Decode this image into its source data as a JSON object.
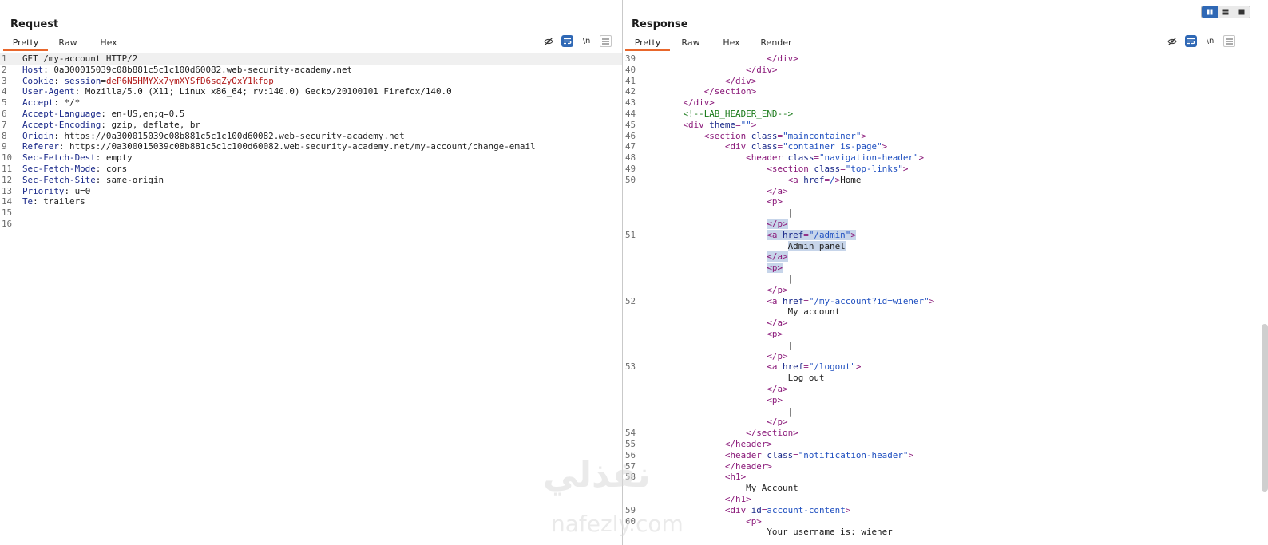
{
  "request": {
    "title": "Request",
    "tabs": [
      "Pretty",
      "Raw",
      "Hex"
    ],
    "active_tab": "Pretty",
    "lines": [
      {
        "n": "1",
        "parts": [
          [
            "hv",
            "GET /my-account HTTP/2"
          ]
        ]
      },
      {
        "n": "2",
        "parts": [
          [
            "hk",
            "Host"
          ],
          [
            "hv",
            ": 0a300015039c08b881c5c1c100d60082.web-security-academy.net"
          ]
        ]
      },
      {
        "n": "3",
        "parts": [
          [
            "hk",
            "Cookie"
          ],
          [
            "hv",
            ": "
          ],
          [
            "hk",
            "session"
          ],
          [
            "hv",
            "="
          ],
          [
            "ck",
            "deP6N5HMYXx7ymXYSfD6sqZyOxY1kfop"
          ]
        ]
      },
      {
        "n": "4",
        "parts": [
          [
            "hk",
            "User-Agent"
          ],
          [
            "hv",
            ": Mozilla/5.0 (X11; Linux x86_64; rv:140.0) Gecko/20100101 Firefox/140.0"
          ]
        ]
      },
      {
        "n": "5",
        "parts": [
          [
            "hk",
            "Accept"
          ],
          [
            "hv",
            ": */*"
          ]
        ]
      },
      {
        "n": "6",
        "parts": [
          [
            "hk",
            "Accept-Language"
          ],
          [
            "hv",
            ": en-US,en;q=0.5"
          ]
        ]
      },
      {
        "n": "7",
        "parts": [
          [
            "hk",
            "Accept-Encoding"
          ],
          [
            "hv",
            ": gzip, deflate, br"
          ]
        ]
      },
      {
        "n": "8",
        "parts": [
          [
            "hk",
            "Origin"
          ],
          [
            "hv",
            ": https://0a300015039c08b881c5c1c100d60082.web-security-academy.net"
          ]
        ]
      },
      {
        "n": "9",
        "parts": [
          [
            "hk",
            "Referer"
          ],
          [
            "hv",
            ": https://0a300015039c08b881c5c1c100d60082.web-security-academy.net/my-account/change-email"
          ]
        ]
      },
      {
        "n": "10",
        "parts": [
          [
            "hk",
            "Sec-Fetch-Dest"
          ],
          [
            "hv",
            ": empty"
          ]
        ]
      },
      {
        "n": "11",
        "parts": [
          [
            "hk",
            "Sec-Fetch-Mode"
          ],
          [
            "hv",
            ": cors"
          ]
        ]
      },
      {
        "n": "12",
        "parts": [
          [
            "hk",
            "Sec-Fetch-Site"
          ],
          [
            "hv",
            ": same-origin"
          ]
        ]
      },
      {
        "n": "13",
        "parts": [
          [
            "hk",
            "Priority"
          ],
          [
            "hv",
            ": u=0"
          ]
        ]
      },
      {
        "n": "14",
        "parts": [
          [
            "hk",
            "Te"
          ],
          [
            "hv",
            ": trailers"
          ]
        ]
      },
      {
        "n": "15",
        "parts": []
      },
      {
        "n": "16",
        "parts": []
      }
    ]
  },
  "response": {
    "title": "Response",
    "tabs": [
      "Pretty",
      "Raw",
      "Hex",
      "Render"
    ],
    "active_tab": "Pretty",
    "lines": [
      {
        "n": "39",
        "parts": [
          [
            "hv",
            "                        "
          ],
          [
            "tg",
            "</div>"
          ]
        ]
      },
      {
        "n": "40",
        "parts": [
          [
            "hv",
            "                    "
          ],
          [
            "tg",
            "</div>"
          ]
        ]
      },
      {
        "n": "41",
        "parts": [
          [
            "hv",
            "                "
          ],
          [
            "tg",
            "</div>"
          ]
        ]
      },
      {
        "n": "42",
        "parts": [
          [
            "hv",
            "            "
          ],
          [
            "tg",
            "</section>"
          ]
        ]
      },
      {
        "n": "43",
        "parts": [
          [
            "hv",
            "        "
          ],
          [
            "tg",
            "</div>"
          ]
        ]
      },
      {
        "n": "44",
        "parts": [
          [
            "hv",
            "        "
          ],
          [
            "cm",
            "<!--LAB_HEADER_END-->"
          ]
        ]
      },
      {
        "n": "45",
        "parts": [
          [
            "hv",
            "        "
          ],
          [
            "tg",
            "<div "
          ],
          [
            "at",
            "theme"
          ],
          [
            "tg",
            "="
          ],
          [
            "av",
            "\"\""
          ],
          [
            "tg",
            ">"
          ]
        ]
      },
      {
        "n": "46",
        "parts": [
          [
            "hv",
            "            "
          ],
          [
            "tg",
            "<section "
          ],
          [
            "at",
            "class"
          ],
          [
            "tg",
            "="
          ],
          [
            "av",
            "\"maincontainer\""
          ],
          [
            "tg",
            ">"
          ]
        ]
      },
      {
        "n": "47",
        "parts": [
          [
            "hv",
            "                "
          ],
          [
            "tg",
            "<div "
          ],
          [
            "at",
            "class"
          ],
          [
            "tg",
            "="
          ],
          [
            "av",
            "\"container is-page\""
          ],
          [
            "tg",
            ">"
          ]
        ]
      },
      {
        "n": "48",
        "parts": [
          [
            "hv",
            "                    "
          ],
          [
            "tg",
            "<header "
          ],
          [
            "at",
            "class"
          ],
          [
            "tg",
            "="
          ],
          [
            "av",
            "\"navigation-header\""
          ],
          [
            "tg",
            ">"
          ]
        ]
      },
      {
        "n": "49",
        "parts": [
          [
            "hv",
            "                        "
          ],
          [
            "tg",
            "<section "
          ],
          [
            "at",
            "class"
          ],
          [
            "tg",
            "="
          ],
          [
            "av",
            "\"top-links\""
          ],
          [
            "tg",
            ">"
          ]
        ]
      },
      {
        "n": "50",
        "parts": [
          [
            "hv",
            "                            "
          ],
          [
            "tg",
            "<a "
          ],
          [
            "at",
            "href"
          ],
          [
            "tg",
            "="
          ],
          [
            "av",
            "/"
          ],
          [
            "tg",
            ">"
          ],
          [
            "hv",
            "Home"
          ]
        ]
      },
      {
        "n": "",
        "parts": [
          [
            "hv",
            "                        "
          ],
          [
            "tg",
            "</a>"
          ]
        ]
      },
      {
        "n": "",
        "parts": [
          [
            "hv",
            "                        "
          ],
          [
            "tg",
            "<p>"
          ]
        ]
      },
      {
        "n": "",
        "parts": [
          [
            "hv",
            "                            |"
          ]
        ]
      },
      {
        "n": "",
        "sel": true,
        "parts": [
          [
            "hv",
            "                        "
          ],
          [
            "tg",
            "</p>"
          ]
        ]
      },
      {
        "n": "51",
        "sel": true,
        "parts": [
          [
            "hv",
            "                        "
          ],
          [
            "tg",
            "<a "
          ],
          [
            "at",
            "href"
          ],
          [
            "tg",
            "="
          ],
          [
            "av",
            "\"/admin\""
          ],
          [
            "tg",
            ">"
          ]
        ]
      },
      {
        "n": "",
        "sel": true,
        "parts": [
          [
            "hv",
            "                            Admin panel"
          ]
        ]
      },
      {
        "n": "",
        "sel": true,
        "parts": [
          [
            "hv",
            "                        "
          ],
          [
            "tg",
            "</a>"
          ]
        ]
      },
      {
        "n": "",
        "sel": true,
        "caret": true,
        "parts": [
          [
            "hv",
            "                        "
          ],
          [
            "tg",
            "<p>"
          ]
        ]
      },
      {
        "n": "",
        "parts": [
          [
            "hv",
            "                            |"
          ]
        ]
      },
      {
        "n": "",
        "parts": [
          [
            "hv",
            "                        "
          ],
          [
            "tg",
            "</p>"
          ]
        ]
      },
      {
        "n": "52",
        "parts": [
          [
            "hv",
            "                        "
          ],
          [
            "tg",
            "<a "
          ],
          [
            "at",
            "href"
          ],
          [
            "tg",
            "="
          ],
          [
            "av",
            "\"/my-account?id=wiener\""
          ],
          [
            "tg",
            ">"
          ]
        ]
      },
      {
        "n": "",
        "parts": [
          [
            "hv",
            "                            My account"
          ]
        ]
      },
      {
        "n": "",
        "parts": [
          [
            "hv",
            "                        "
          ],
          [
            "tg",
            "</a>"
          ]
        ]
      },
      {
        "n": "",
        "parts": [
          [
            "hv",
            "                        "
          ],
          [
            "tg",
            "<p>"
          ]
        ]
      },
      {
        "n": "",
        "parts": [
          [
            "hv",
            "                            |"
          ]
        ]
      },
      {
        "n": "",
        "parts": [
          [
            "hv",
            "                        "
          ],
          [
            "tg",
            "</p>"
          ]
        ]
      },
      {
        "n": "53",
        "parts": [
          [
            "hv",
            "                        "
          ],
          [
            "tg",
            "<a "
          ],
          [
            "at",
            "href"
          ],
          [
            "tg",
            "="
          ],
          [
            "av",
            "\"/logout\""
          ],
          [
            "tg",
            ">"
          ]
        ]
      },
      {
        "n": "",
        "parts": [
          [
            "hv",
            "                            Log out"
          ]
        ]
      },
      {
        "n": "",
        "parts": [
          [
            "hv",
            "                        "
          ],
          [
            "tg",
            "</a>"
          ]
        ]
      },
      {
        "n": "",
        "parts": [
          [
            "hv",
            "                        "
          ],
          [
            "tg",
            "<p>"
          ]
        ]
      },
      {
        "n": "",
        "parts": [
          [
            "hv",
            "                            |"
          ]
        ]
      },
      {
        "n": "",
        "parts": [
          [
            "hv",
            "                        "
          ],
          [
            "tg",
            "</p>"
          ]
        ]
      },
      {
        "n": "54",
        "parts": [
          [
            "hv",
            "                    "
          ],
          [
            "tg",
            "</section>"
          ]
        ]
      },
      {
        "n": "55",
        "parts": [
          [
            "hv",
            "                "
          ],
          [
            "tg",
            "</header>"
          ]
        ]
      },
      {
        "n": "56",
        "parts": [
          [
            "hv",
            "                "
          ],
          [
            "tg",
            "<header "
          ],
          [
            "at",
            "class"
          ],
          [
            "tg",
            "="
          ],
          [
            "av",
            "\"notification-header\""
          ],
          [
            "tg",
            ">"
          ]
        ]
      },
      {
        "n": "57",
        "parts": [
          [
            "hv",
            "                "
          ],
          [
            "tg",
            "</header>"
          ]
        ]
      },
      {
        "n": "58",
        "parts": [
          [
            "hv",
            "                "
          ],
          [
            "tg",
            "<h1>"
          ]
        ]
      },
      {
        "n": "",
        "parts": [
          [
            "hv",
            "                    My Account"
          ]
        ]
      },
      {
        "n": "",
        "parts": [
          [
            "hv",
            "                "
          ],
          [
            "tg",
            "</h1>"
          ]
        ]
      },
      {
        "n": "59",
        "parts": [
          [
            "hv",
            "                "
          ],
          [
            "tg",
            "<div "
          ],
          [
            "at",
            "id"
          ],
          [
            "tg",
            "="
          ],
          [
            "av",
            "account-content"
          ],
          [
            "tg",
            ">"
          ]
        ]
      },
      {
        "n": "60",
        "parts": [
          [
            "hv",
            "                    "
          ],
          [
            "tg",
            "<p>"
          ]
        ]
      },
      {
        "n": "",
        "parts": [
          [
            "hv",
            "                        Your username is: wiener"
          ]
        ]
      }
    ]
  },
  "toolbar_icons": [
    "eye-off-icon",
    "word-wrap-icon",
    "newline-icon",
    "menu-icon"
  ],
  "newline_label": "\\n",
  "watermark": {
    "arabic": "نفذلي",
    "latin": "nafezly.com"
  }
}
